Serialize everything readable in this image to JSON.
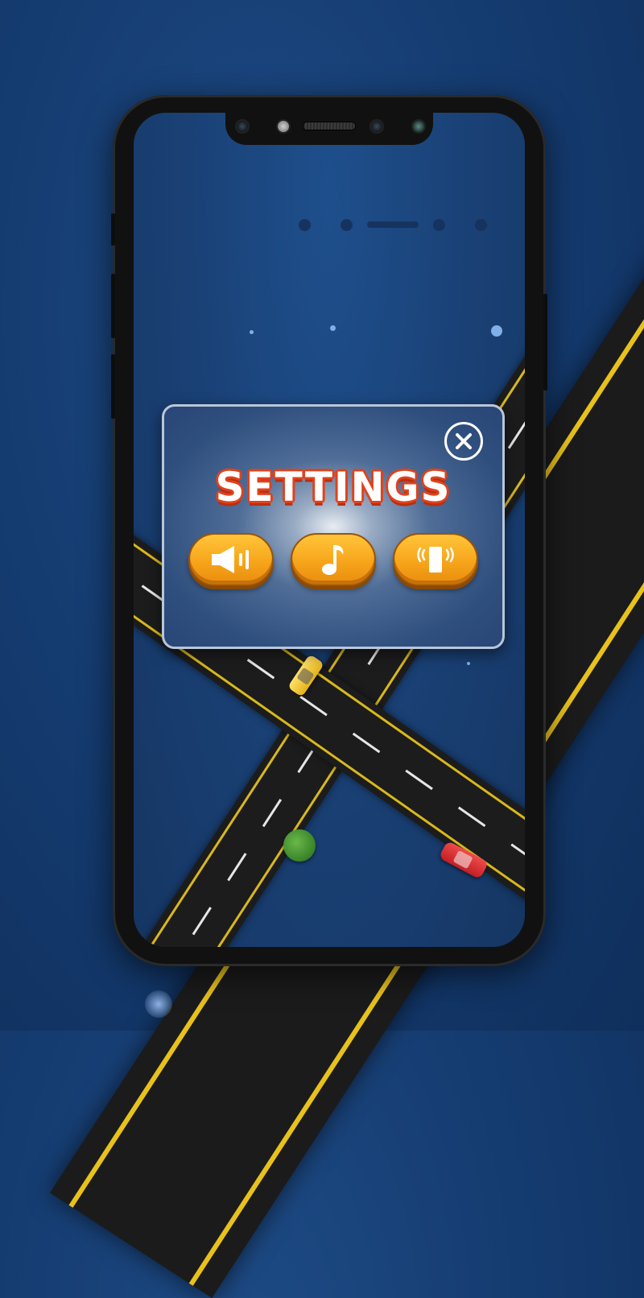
{
  "dialog": {
    "title": "SETTINGS",
    "close_icon": "close-icon",
    "buttons": [
      {
        "name": "sound-button",
        "icon": "speaker-icon"
      },
      {
        "name": "music-button",
        "icon": "music-note-icon"
      },
      {
        "name": "vibration-button",
        "icon": "vibration-icon"
      }
    ]
  },
  "colors": {
    "background": "#143a6e",
    "title_fill": "#ffffff",
    "title_outline": "#e0421c",
    "button_orange": "#f7a51b",
    "road": "#1c1c1d",
    "road_line": "#d9b81c"
  },
  "progress": {
    "dots": 4,
    "bars": 1
  }
}
